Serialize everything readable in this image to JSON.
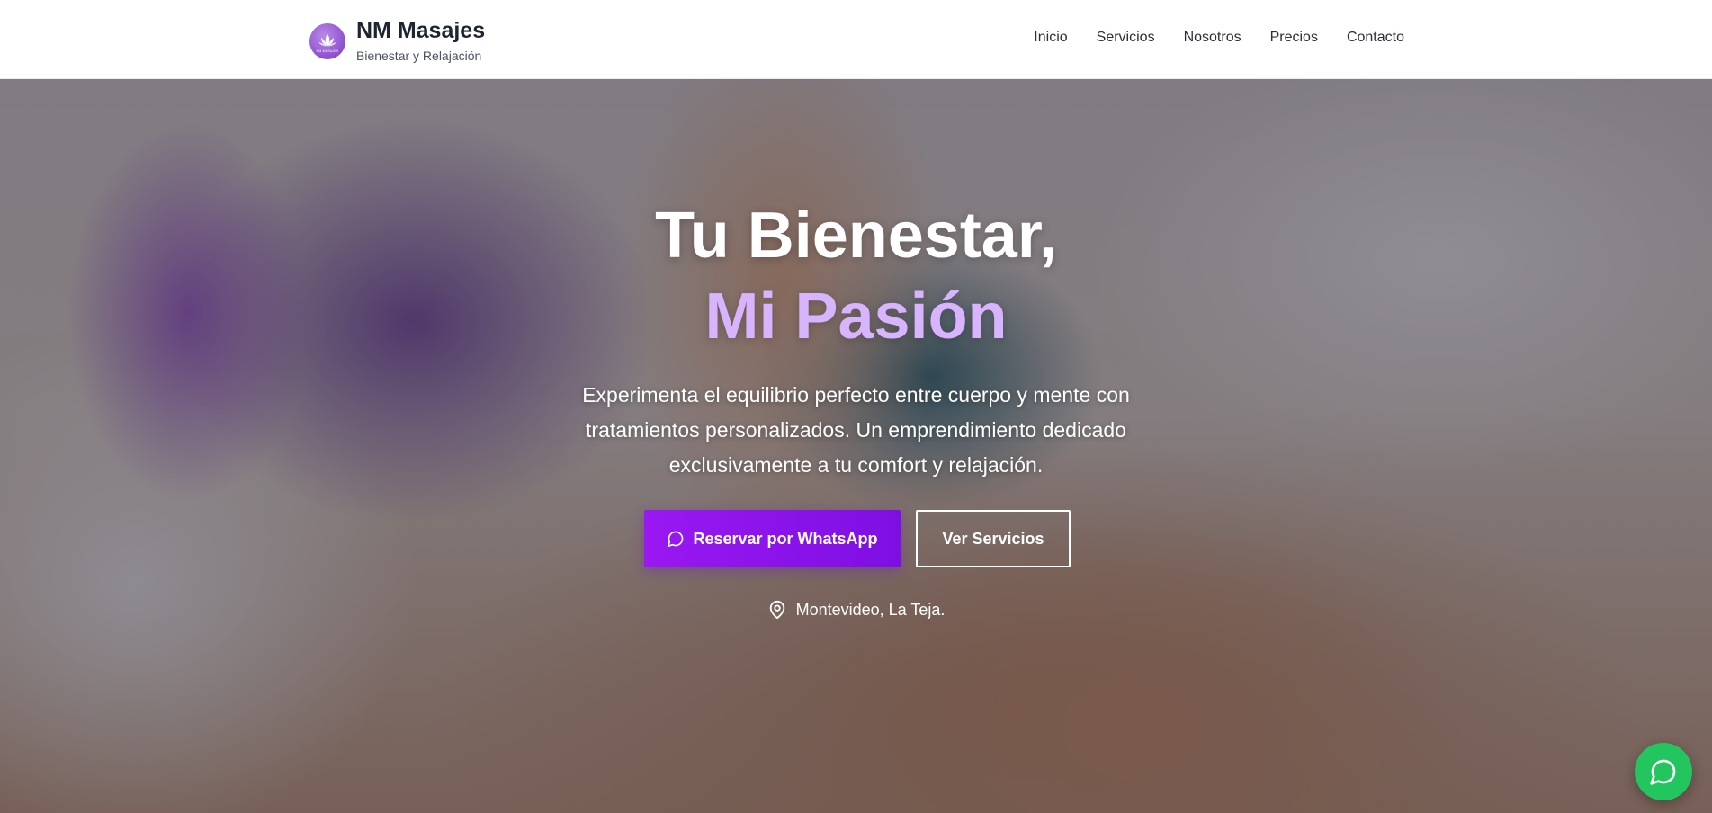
{
  "brand": {
    "name": "NM Masajes",
    "tagline": "Bienestar y Relajación",
    "logo_text": "NM MASAJES",
    "logo_icon": "lotus-icon",
    "logo_color": "#8e4fd0"
  },
  "nav": {
    "items": [
      {
        "label": "Inicio"
      },
      {
        "label": "Servicios"
      },
      {
        "label": "Nosotros"
      },
      {
        "label": "Precios"
      },
      {
        "label": "Contacto"
      }
    ]
  },
  "hero": {
    "title": "Tu Bienestar,",
    "title_accent": "Mi Pasión",
    "subtitle": "Experimenta el equilibrio perfecto entre cuerpo y mente con tratamientos personalizados. Un emprendimiento dedicado exclusivamente a tu comfort y relajación.",
    "primary_button": "Reservar por WhatsApp",
    "primary_button_icon": "chat-bubble-icon",
    "secondary_button": "Ver Servicios",
    "location_icon": "map-pin-icon",
    "location": "Montevideo, La Teja."
  },
  "floating_button": {
    "icon": "whatsapp-icon",
    "color": "#22c55e"
  },
  "colors": {
    "accent": "#8b12ee",
    "title_accent": "#d8b4fe",
    "text_dark": "#1f2433"
  }
}
